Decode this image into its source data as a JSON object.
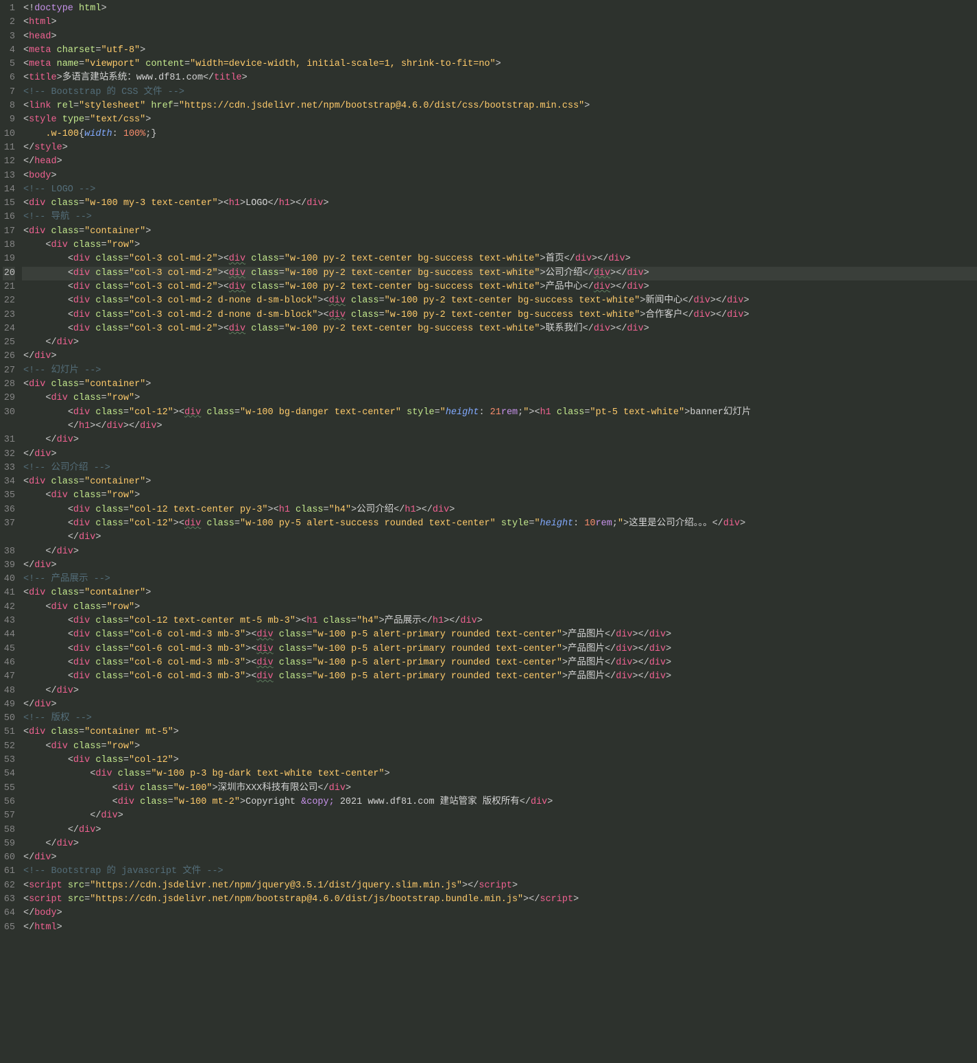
{
  "lines": [
    {
      "n": 1,
      "html": "<span class='p'>&lt;!</span><span class='doctype'>doctype</span><span class='p'> </span><span class='a'>html</span><span class='p'>&gt;</span>"
    },
    {
      "n": 2,
      "html": "<span class='p'>&lt;</span><span class='t'>html</span><span class='p'>&gt;</span>"
    },
    {
      "n": 3,
      "html": "<span class='p'>&lt;</span><span class='t'>head</span><span class='p'>&gt;</span>"
    },
    {
      "n": 4,
      "html": "<span class='p'>&lt;</span><span class='t'>meta</span> <span class='a'>charset</span><span class='p'>=</span><span class='s'>\"utf-8\"</span><span class='p'>&gt;</span>"
    },
    {
      "n": 5,
      "html": "<span class='p'>&lt;</span><span class='t'>meta</span> <span class='a'>name</span><span class='p'>=</span><span class='s'>\"viewport\"</span> <span class='a'>content</span><span class='p'>=</span><span class='s'>\"width=device-width, initial-scale=1, shrink-to-fit=no\"</span><span class='p'>&gt;</span>"
    },
    {
      "n": 6,
      "html": "<span class='p'>&lt;</span><span class='t'>title</span><span class='p'>&gt;</span><span class='tx'>多语言建站系统：www.df81.com</span><span class='p'>&lt;/</span><span class='t'>title</span><span class='p'>&gt;</span>"
    },
    {
      "n": 7,
      "html": "<span class='c'>&lt;!-- Bootstrap 的 CSS 文件 --&gt;</span>"
    },
    {
      "n": 8,
      "html": "<span class='p'>&lt;</span><span class='t'>link</span> <span class='a'>rel</span><span class='p'>=</span><span class='s'>\"stylesheet\"</span> <span class='a'>href</span><span class='p'>=</span><span class='s'>\"https://cdn.jsdelivr.net/npm/bootstrap@4.6.0/dist/css/bootstrap.min.css\"</span><span class='p'>&gt;</span>"
    },
    {
      "n": 9,
      "html": "<span class='p'>&lt;</span><span class='t'>style</span> <span class='a'>type</span><span class='p'>=</span><span class='s'>\"text/css\"</span><span class='p'>&gt;</span>"
    },
    {
      "n": 10,
      "html": "    <span class='sel'>.w-100</span><span class='p'>{</span><span class='pr it'>width</span><span class='p'>: </span><span class='num'>100%</span><span class='p'>;}</span>"
    },
    {
      "n": 11,
      "html": "<span class='p'>&lt;/</span><span class='t'>style</span><span class='p'>&gt;</span>"
    },
    {
      "n": 12,
      "html": "<span class='p'>&lt;/</span><span class='t'>head</span><span class='p'>&gt;</span>"
    },
    {
      "n": 13,
      "html": "<span class='p'>&lt;</span><span class='t'>body</span><span class='p'>&gt;</span>"
    },
    {
      "n": 14,
      "html": "<span class='c'>&lt;!-- LOGO --&gt;</span>"
    },
    {
      "n": 15,
      "html": "<span class='p'>&lt;</span><span class='t'>div</span> <span class='a'>class</span><span class='p'>=</span><span class='s'>\"w-100 my-3 text-center\"</span><span class='p'>&gt;&lt;</span><span class='t'>h1</span><span class='p'>&gt;</span><span class='tx'>LOGO</span><span class='p'>&lt;/</span><span class='t'>h1</span><span class='p'>&gt;&lt;/</span><span class='t'>div</span><span class='p'>&gt;</span>"
    },
    {
      "n": 16,
      "html": "<span class='c'>&lt;!-- 导航 --&gt;</span>"
    },
    {
      "n": 17,
      "html": "<span class='p'>&lt;</span><span class='t'>div</span> <span class='a'>class</span><span class='p'>=</span><span class='s'>\"container\"</span><span class='p'>&gt;</span>"
    },
    {
      "n": 18,
      "html": "    <span class='p'>&lt;</span><span class='t'>div</span> <span class='a'>class</span><span class='p'>=</span><span class='s'>\"row\"</span><span class='p'>&gt;</span>"
    },
    {
      "n": 19,
      "html": "        <span class='p'>&lt;</span><span class='t'>div</span> <span class='a'>class</span><span class='p'>=</span><span class='s'>\"col-3 col-md-2\"</span><span class='p'>&gt;&lt;</span><span class='t underline'>div</span> <span class='a'>class</span><span class='p'>=</span><span class='s'>\"w-100 py-2 text-center bg-success text-white\"</span><span class='p'>&gt;</span><span class='tx'>首页</span><span class='p'>&lt;/</span><span class='t'>div</span><span class='p'>&gt;&lt;/</span><span class='t'>div</span><span class='p'>&gt;</span>"
    },
    {
      "n": 20,
      "active": true,
      "html": "        <span class='p'>&lt;</span><span class='t'>div</span> <span class='a'>class</span><span class='p'>=</span><span class='s'>\"col-3 col-md-2\"</span><span class='p'>&gt;&lt;</span><span class='t underline'>div</span> <span class='a'>class</span><span class='p'>=</span><span class='s'>\"w-100 py-2 text-center bg-success text-white\"</span><span class='p'>&gt;</span><span class='tx'>公司介绍</span><span class='p'>&lt;/</span><span class='t underline'>div</span><span class='p'>&gt;&lt;/</span><span class='t'>div</span><span class='p'>&gt;</span>"
    },
    {
      "n": 21,
      "html": "        <span class='p'>&lt;</span><span class='t'>div</span> <span class='a'>class</span><span class='p'>=</span><span class='s'>\"col-3 col-md-2\"</span><span class='p'>&gt;&lt;</span><span class='t underline'>div</span> <span class='a'>class</span><span class='p'>=</span><span class='s'>\"w-100 py-2 text-center bg-success text-white\"</span><span class='p'>&gt;</span><span class='tx'>产品中心</span><span class='p'>&lt;/</span><span class='t underline'>div</span><span class='p'>&gt;&lt;/</span><span class='t'>div</span><span class='p'>&gt;</span>"
    },
    {
      "n": 22,
      "html": "        <span class='p'>&lt;</span><span class='t'>div</span> <span class='a'>class</span><span class='p'>=</span><span class='s'>\"col-3 col-md-2 d-none d-sm-block\"</span><span class='p'>&gt;&lt;</span><span class='t underline'>div</span> <span class='a'>class</span><span class='p'>=</span><span class='s'>\"w-100 py-2 text-center bg-success text-white\"</span><span class='p'>&gt;</span><span class='tx'>新闻中心</span><span class='p'>&lt;/</span><span class='t'>div</span><span class='p'>&gt;&lt;/</span><span class='t'>div</span><span class='p'>&gt;</span>"
    },
    {
      "n": 23,
      "html": "        <span class='p'>&lt;</span><span class='t'>div</span> <span class='a'>class</span><span class='p'>=</span><span class='s'>\"col-3 col-md-2 d-none d-sm-block\"</span><span class='p'>&gt;&lt;</span><span class='t underline'>div</span> <span class='a'>class</span><span class='p'>=</span><span class='s'>\"w-100 py-2 text-center bg-success text-white\"</span><span class='p'>&gt;</span><span class='tx'>合作客户</span><span class='p'>&lt;/</span><span class='t'>div</span><span class='p'>&gt;&lt;/</span><span class='t'>div</span><span class='p'>&gt;</span>"
    },
    {
      "n": 24,
      "html": "        <span class='p'>&lt;</span><span class='t'>div</span> <span class='a'>class</span><span class='p'>=</span><span class='s'>\"col-3 col-md-2\"</span><span class='p'>&gt;&lt;</span><span class='t underline'>div</span> <span class='a'>class</span><span class='p'>=</span><span class='s'>\"w-100 py-2 text-center bg-success text-white\"</span><span class='p'>&gt;</span><span class='tx'>联系我们</span><span class='p'>&lt;/</span><span class='t'>div</span><span class='p'>&gt;&lt;/</span><span class='t'>div</span><span class='p'>&gt;</span>"
    },
    {
      "n": 25,
      "html": "    <span class='p'>&lt;/</span><span class='t'>div</span><span class='p'>&gt;</span>"
    },
    {
      "n": 26,
      "html": "<span class='p'>&lt;/</span><span class='t'>div</span><span class='p'>&gt;</span>"
    },
    {
      "n": 27,
      "html": "<span class='c'>&lt;!-- 幻灯片 --&gt;</span>"
    },
    {
      "n": 28,
      "html": "<span class='p'>&lt;</span><span class='t'>div</span> <span class='a'>class</span><span class='p'>=</span><span class='s'>\"container\"</span><span class='p'>&gt;</span>"
    },
    {
      "n": 29,
      "html": "    <span class='p'>&lt;</span><span class='t'>div</span> <span class='a'>class</span><span class='p'>=</span><span class='s'>\"row\"</span><span class='p'>&gt;</span>"
    },
    {
      "n": 30,
      "html": "        <span class='p'>&lt;</span><span class='t'>div</span> <span class='a'>class</span><span class='p'>=</span><span class='s'>\"col-12\"</span><span class='p'>&gt;&lt;</span><span class='t underline'>div</span> <span class='a'>class</span><span class='p'>=</span><span class='s'>\"w-100 bg-danger text-center\"</span> <span class='a'>style</span><span class='p'>=</span><span class='s'>\"</span><span class='pr it'>height</span><span class='p'>: </span><span class='num'>21</span><span class='kw'>rem</span><span class='p'>;</span><span class='s'>\"</span><span class='p'>&gt;&lt;</span><span class='t'>h1</span> <span class='a'>class</span><span class='p'>=</span><span class='s'>\"pt-5 text-white\"</span><span class='p'>&gt;</span><span class='tx'>banner幻灯片</span>"
    },
    {
      "n": "",
      "html": "        <span class='p'>&lt;/</span><span class='t'>h1</span><span class='p'>&gt;&lt;/</span><span class='t'>div</span><span class='p'>&gt;&lt;/</span><span class='t'>div</span><span class='p'>&gt;</span>"
    },
    {
      "n": 31,
      "html": "    <span class='p'>&lt;/</span><span class='t'>div</span><span class='p'>&gt;</span>"
    },
    {
      "n": 32,
      "html": "<span class='p'>&lt;/</span><span class='t'>div</span><span class='p'>&gt;</span>"
    },
    {
      "n": 33,
      "html": "<span class='c'>&lt;!-- 公司介绍 --&gt;</span>"
    },
    {
      "n": 34,
      "html": "<span class='p'>&lt;</span><span class='t'>div</span> <span class='a'>class</span><span class='p'>=</span><span class='s'>\"container\"</span><span class='p'>&gt;</span>"
    },
    {
      "n": 35,
      "html": "    <span class='p'>&lt;</span><span class='t'>div</span> <span class='a'>class</span><span class='p'>=</span><span class='s'>\"row\"</span><span class='p'>&gt;</span>"
    },
    {
      "n": 36,
      "html": "        <span class='p'>&lt;</span><span class='t'>div</span> <span class='a'>class</span><span class='p'>=</span><span class='s'>\"col-12 text-center py-3\"</span><span class='p'>&gt;&lt;</span><span class='t'>h1</span> <span class='a'>class</span><span class='p'>=</span><span class='s'>\"h4\"</span><span class='p'>&gt;</span><span class='tx'>公司介绍</span><span class='p'>&lt;/</span><span class='t'>h1</span><span class='p'>&gt;&lt;/</span><span class='t'>div</span><span class='p'>&gt;</span>"
    },
    {
      "n": 37,
      "html": "        <span class='p'>&lt;</span><span class='t'>div</span> <span class='a'>class</span><span class='p'>=</span><span class='s'>\"col-12\"</span><span class='p'>&gt;&lt;</span><span class='t underline'>div</span> <span class='a'>class</span><span class='p'>=</span><span class='s'>\"w-100 py-5 alert-success rounded text-center\"</span> <span class='a'>style</span><span class='p'>=</span><span class='s'>\"</span><span class='pr it'>height</span><span class='p'>: </span><span class='num'>10</span><span class='kw'>rem</span><span class='p'>;</span><span class='s'>\"</span><span class='p'>&gt;</span><span class='tx'>这里是公司介绍。。。</span><span class='p'>&lt;/</span><span class='t'>div</span><span class='p'>&gt;</span>"
    },
    {
      "n": "",
      "html": "        <span class='p'>&lt;/</span><span class='t'>div</span><span class='p'>&gt;</span>"
    },
    {
      "n": 38,
      "html": "    <span class='p'>&lt;/</span><span class='t'>div</span><span class='p'>&gt;</span>"
    },
    {
      "n": 39,
      "html": "<span class='p'>&lt;/</span><span class='t'>div</span><span class='p'>&gt;</span>"
    },
    {
      "n": 40,
      "html": "<span class='c'>&lt;!-- 产品展示 --&gt;</span>"
    },
    {
      "n": 41,
      "html": "<span class='p'>&lt;</span><span class='t'>div</span> <span class='a'>class</span><span class='p'>=</span><span class='s'>\"container\"</span><span class='p'>&gt;</span>"
    },
    {
      "n": 42,
      "html": "    <span class='p'>&lt;</span><span class='t'>div</span> <span class='a'>class</span><span class='p'>=</span><span class='s'>\"row\"</span><span class='p'>&gt;</span>"
    },
    {
      "n": 43,
      "html": "        <span class='p'>&lt;</span><span class='t'>div</span> <span class='a'>class</span><span class='p'>=</span><span class='s'>\"col-12 text-center mt-5 mb-3\"</span><span class='p'>&gt;&lt;</span><span class='t'>h1</span> <span class='a'>class</span><span class='p'>=</span><span class='s'>\"h4\"</span><span class='p'>&gt;</span><span class='tx'>产品展示</span><span class='p'>&lt;/</span><span class='t'>h1</span><span class='p'>&gt;&lt;/</span><span class='t'>div</span><span class='p'>&gt;</span>"
    },
    {
      "n": 44,
      "html": "        <span class='p'>&lt;</span><span class='t'>div</span> <span class='a'>class</span><span class='p'>=</span><span class='s'>\"col-6 col-md-3 mb-3\"</span><span class='p'>&gt;&lt;</span><span class='t underline'>div</span> <span class='a'>class</span><span class='p'>=</span><span class='s'>\"w-100 p-5 alert-primary rounded text-center\"</span><span class='p'>&gt;</span><span class='tx'>产品图片</span><span class='p'>&lt;/</span><span class='t'>div</span><span class='p'>&gt;&lt;/</span><span class='t'>div</span><span class='p'>&gt;</span>"
    },
    {
      "n": 45,
      "html": "        <span class='p'>&lt;</span><span class='t'>div</span> <span class='a'>class</span><span class='p'>=</span><span class='s'>\"col-6 col-md-3 mb-3\"</span><span class='p'>&gt;&lt;</span><span class='t underline'>div</span> <span class='a'>class</span><span class='p'>=</span><span class='s'>\"w-100 p-5 alert-primary rounded text-center\"</span><span class='p'>&gt;</span><span class='tx'>产品图片</span><span class='p'>&lt;/</span><span class='t'>div</span><span class='p'>&gt;&lt;/</span><span class='t'>div</span><span class='p'>&gt;</span>"
    },
    {
      "n": 46,
      "html": "        <span class='p'>&lt;</span><span class='t'>div</span> <span class='a'>class</span><span class='p'>=</span><span class='s'>\"col-6 col-md-3 mb-3\"</span><span class='p'>&gt;&lt;</span><span class='t underline'>div</span> <span class='a'>class</span><span class='p'>=</span><span class='s'>\"w-100 p-5 alert-primary rounded text-center\"</span><span class='p'>&gt;</span><span class='tx'>产品图片</span><span class='p'>&lt;/</span><span class='t'>div</span><span class='p'>&gt;&lt;/</span><span class='t'>div</span><span class='p'>&gt;</span>"
    },
    {
      "n": 47,
      "html": "        <span class='p'>&lt;</span><span class='t'>div</span> <span class='a'>class</span><span class='p'>=</span><span class='s'>\"col-6 col-md-3 mb-3\"</span><span class='p'>&gt;&lt;</span><span class='t underline'>div</span> <span class='a'>class</span><span class='p'>=</span><span class='s'>\"w-100 p-5 alert-primary rounded text-center\"</span><span class='p'>&gt;</span><span class='tx'>产品图片</span><span class='p'>&lt;/</span><span class='t'>div</span><span class='p'>&gt;&lt;/</span><span class='t'>div</span><span class='p'>&gt;</span>"
    },
    {
      "n": 48,
      "html": "    <span class='p'>&lt;/</span><span class='t'>div</span><span class='p'>&gt;</span>"
    },
    {
      "n": 49,
      "html": "<span class='p'>&lt;/</span><span class='t'>div</span><span class='p'>&gt;</span>"
    },
    {
      "n": 50,
      "html": "<span class='c'>&lt;!-- 版权 --&gt;</span>"
    },
    {
      "n": 51,
      "html": "<span class='p'>&lt;</span><span class='t'>div</span> <span class='a'>class</span><span class='p'>=</span><span class='s'>\"container mt-5\"</span><span class='p'>&gt;</span>"
    },
    {
      "n": 52,
      "html": "    <span class='p'>&lt;</span><span class='t'>div</span> <span class='a'>class</span><span class='p'>=</span><span class='s'>\"row\"</span><span class='p'>&gt;</span>"
    },
    {
      "n": 53,
      "html": "        <span class='p'>&lt;</span><span class='t'>div</span> <span class='a'>class</span><span class='p'>=</span><span class='s'>\"col-12\"</span><span class='p'>&gt;</span>"
    },
    {
      "n": 54,
      "html": "            <span class='p'>&lt;</span><span class='t'>div</span> <span class='a'>class</span><span class='p'>=</span><span class='s'>\"w-100 p-3 bg-dark text-white text-center\"</span><span class='p'>&gt;</span>"
    },
    {
      "n": 55,
      "html": "                <span class='p'>&lt;</span><span class='t'>div</span> <span class='a'>class</span><span class='p'>=</span><span class='s'>\"w-100\"</span><span class='p'>&gt;</span><span class='tx'>深圳市XXX科技有限公司</span><span class='p'>&lt;/</span><span class='t'>div</span><span class='p'>&gt;</span>"
    },
    {
      "n": 56,
      "html": "                <span class='p'>&lt;</span><span class='t'>div</span> <span class='a'>class</span><span class='p'>=</span><span class='s'>\"w-100 mt-2\"</span><span class='p'>&gt;</span><span class='tx'>Copyright </span><span class='kw'>&amp;copy;</span><span class='tx'> 2021 www.df81.com 建站管家 版权所有</span><span class='p'>&lt;/</span><span class='t'>div</span><span class='p'>&gt;</span>"
    },
    {
      "n": 57,
      "html": "            <span class='p'>&lt;/</span><span class='t'>div</span><span class='p'>&gt;</span>"
    },
    {
      "n": 58,
      "html": "        <span class='p'>&lt;/</span><span class='t'>div</span><span class='p'>&gt;</span>"
    },
    {
      "n": 59,
      "html": "    <span class='p'>&lt;/</span><span class='t'>div</span><span class='p'>&gt;</span>"
    },
    {
      "n": 60,
      "html": "<span class='p'>&lt;/</span><span class='t'>div</span><span class='p'>&gt;</span>"
    },
    {
      "n": 61,
      "html": "<span class='c'>&lt;!-- Bootstrap 的 javascript 文件 --&gt;</span>"
    },
    {
      "n": 62,
      "html": "<span class='p'>&lt;</span><span class='t'>script</span> <span class='a'>src</span><span class='p'>=</span><span class='s'>\"https://cdn.jsdelivr.net/npm/jquery@3.5.1/dist/jquery.slim.min.js\"</span><span class='p'>&gt;&lt;/</span><span class='t'>script</span><span class='p'>&gt;</span>"
    },
    {
      "n": 63,
      "html": "<span class='p'>&lt;</span><span class='t'>script</span> <span class='a'>src</span><span class='p'>=</span><span class='s'>\"https://cdn.jsdelivr.net/npm/bootstrap@4.6.0/dist/js/bootstrap.bundle.min.js\"</span><span class='p'>&gt;&lt;/</span><span class='t'>script</span><span class='p'>&gt;</span>"
    },
    {
      "n": 64,
      "html": "<span class='p'>&lt;/</span><span class='t'>body</span><span class='p'>&gt;</span>"
    },
    {
      "n": 65,
      "html": "<span class='p'>&lt;/</span><span class='t'>html</span><span class='p'>&gt;</span>"
    }
  ]
}
